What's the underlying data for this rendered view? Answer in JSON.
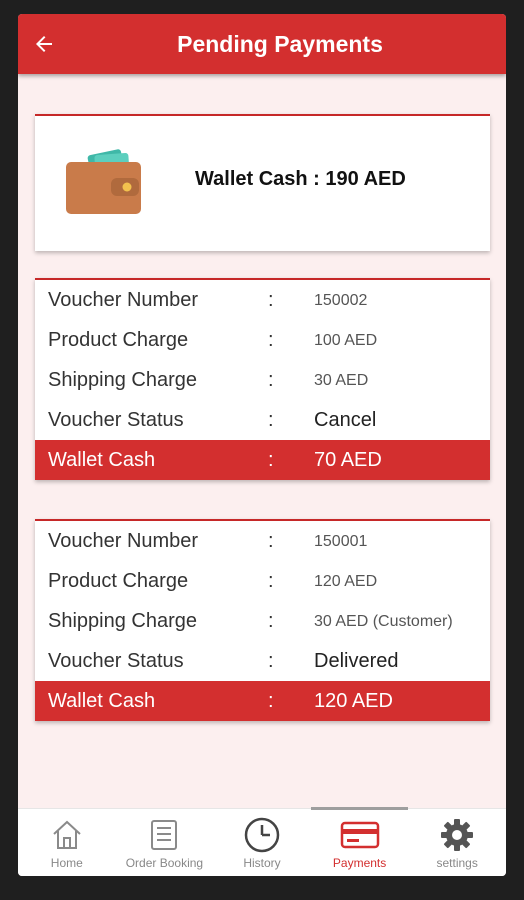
{
  "appbar": {
    "title": "Pending Payments"
  },
  "wallet": {
    "text": "Wallet Cash : 190 AED"
  },
  "vouchers": [
    {
      "rows": [
        {
          "label": "Voucher Number",
          "value": "150002"
        },
        {
          "label": "Product Charge",
          "value": "100 AED"
        },
        {
          "label": "Shipping Charge",
          "value": "30 AED"
        },
        {
          "label": "Voucher Status",
          "value": "Cancel"
        },
        {
          "label": "Wallet Cash",
          "value": "70 AED"
        }
      ]
    },
    {
      "rows": [
        {
          "label": "Voucher Number",
          "value": "150001"
        },
        {
          "label": "Product Charge",
          "value": "120 AED"
        },
        {
          "label": "Shipping Charge",
          "value": "30 AED (Customer)"
        },
        {
          "label": "Voucher Status",
          "value": "Delivered"
        },
        {
          "label": "Wallet Cash",
          "value": "120 AED"
        }
      ]
    }
  ],
  "colon": ":",
  "nav": [
    {
      "label": "Home",
      "icon": "home-icon"
    },
    {
      "label": "Order Booking",
      "icon": "order-booking-icon"
    },
    {
      "label": "History",
      "icon": "clock-icon"
    },
    {
      "label": "Payments",
      "icon": "credit-card-icon",
      "active": true
    },
    {
      "label": "settings",
      "icon": "gear-icon"
    }
  ],
  "colors": {
    "primary": "#d32f2f",
    "background": "#fcefef"
  }
}
